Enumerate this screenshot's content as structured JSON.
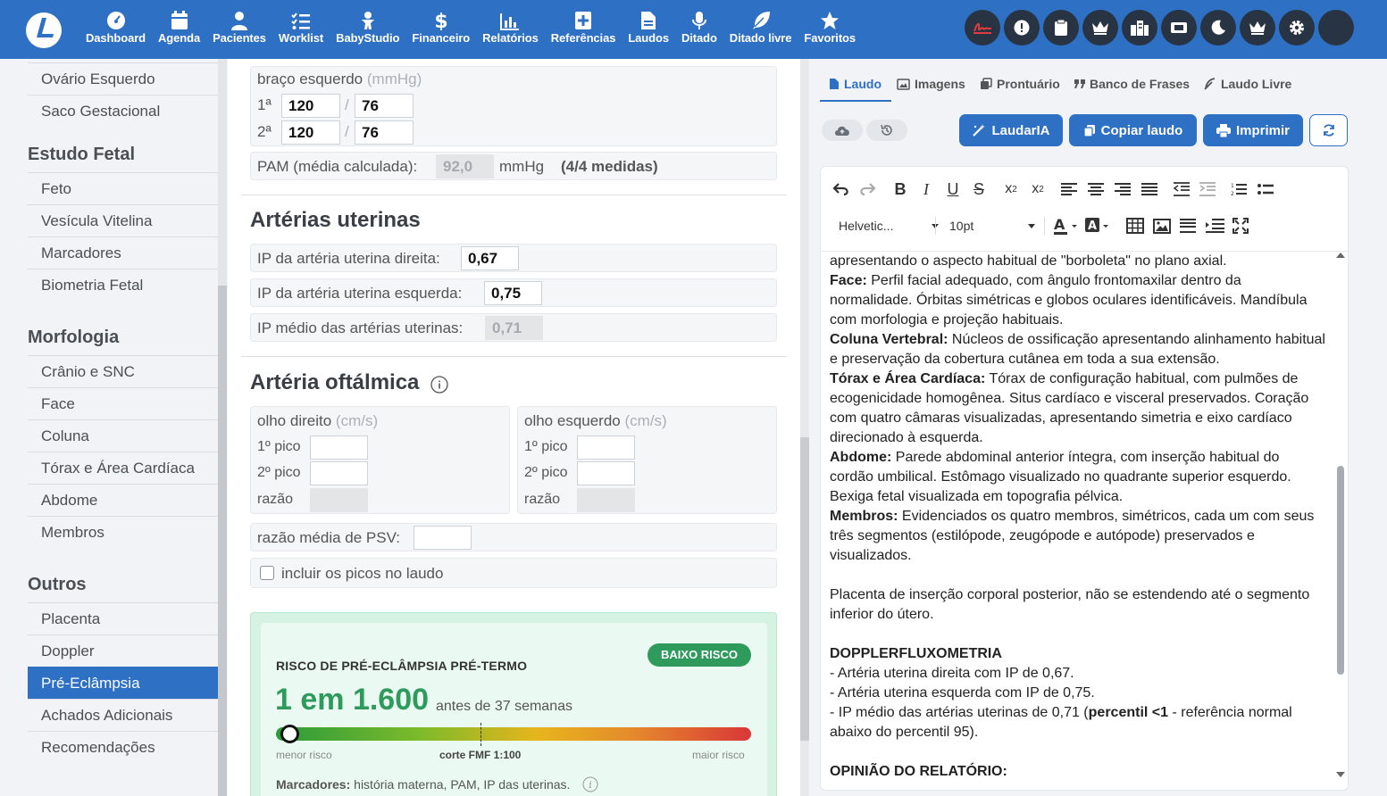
{
  "nav": {
    "items": [
      {
        "label": "Dashboard",
        "icon": "dashboard-icon"
      },
      {
        "label": "Agenda",
        "icon": "calendar-icon"
      },
      {
        "label": "Pacientes",
        "icon": "user-icon"
      },
      {
        "label": "Worklist",
        "icon": "list-check-icon"
      },
      {
        "label": "BabyStudio",
        "icon": "baby-icon"
      },
      {
        "label": "Financeiro",
        "icon": "dollar-icon"
      },
      {
        "label": "Relatórios",
        "icon": "bar-chart-icon"
      },
      {
        "label": "Referências",
        "icon": "book-plus-icon"
      },
      {
        "label": "Laudos",
        "icon": "file-icon"
      },
      {
        "label": "Ditado",
        "icon": "microphone-icon"
      },
      {
        "label": "Ditado livre",
        "icon": "feather-icon"
      },
      {
        "label": "Favoritos",
        "icon": "star-icon"
      }
    ],
    "right_icons": [
      "signature-icon",
      "alert-icon",
      "clipboard-icon",
      "crown-icon",
      "building-icon",
      "ticket-icon",
      "moon-icon",
      "crown-icon",
      "gear-icon",
      "avatar"
    ]
  },
  "sidebar": {
    "items_top": [
      "Ovário Esquerdo",
      "Saco Gestacional"
    ],
    "sections": [
      {
        "title": "Estudo Fetal",
        "items": [
          "Feto",
          "Vesícula Vitelina",
          "Marcadores",
          "Biometria Fetal"
        ]
      },
      {
        "title": "Morfologia",
        "items": [
          "Crânio e SNC",
          "Face",
          "Coluna",
          "Tórax e Área Cardíaca",
          "Abdome",
          "Membros"
        ]
      },
      {
        "title": "Outros",
        "items": [
          "Placenta",
          "Doppler",
          "Pré-Eclâmpsia",
          "Achados Adicionais",
          "Recomendações"
        ]
      }
    ],
    "active": "Pré-Eclâmpsia"
  },
  "bp": {
    "label": "braço esquerdo",
    "unit": "(mmHg)",
    "rows": [
      {
        "ord": "1ª",
        "sys": "120",
        "dia": "76"
      },
      {
        "ord": "2ª",
        "sys": "120",
        "dia": "76"
      }
    ],
    "sep": "/",
    "pam_label": "PAM (média calculada):",
    "pam_value": "92,0",
    "pam_unit": "mmHg",
    "pam_count": "(4/4 medidas)"
  },
  "uterine": {
    "title": "Artérias uterinas",
    "right_label": "IP da artéria uterina direita:",
    "right_value": "0,67",
    "left_label": "IP da artéria uterina esquerda:",
    "left_value": "0,75",
    "mean_label": "IP médio das artérias uterinas:",
    "mean_value": "0,71"
  },
  "ophthalmic": {
    "title": "Artéria oftálmica",
    "right_eye": "olho direito",
    "left_eye": "olho esquerdo",
    "unit": "(cm/s)",
    "peak1": "1º pico",
    "peak2": "2º pico",
    "ratio": "razão",
    "psv_label": "razão média de PSV:",
    "include_label": "incluir os picos no laudo"
  },
  "risk": {
    "title": "RISCO DE PRÉ-ECLÂMPSIA PRÉ-TERMO",
    "badge": "BAIXO RISCO",
    "value": "1 em 1.600",
    "suffix": "antes de 37 semanas",
    "min_label": "menor risco",
    "cut_label": "corte FMF 1:100",
    "max_label": "maior risco",
    "markers_label": "Marcadores:",
    "markers_text": "história materna, PAM, IP das uterinas.",
    "position": 0.03,
    "cutoff_position": 0.43,
    "colors": {
      "badge": "#2e9a5c",
      "value": "#2e9a5c"
    }
  },
  "report": {
    "tabs": [
      {
        "label": "Laudo",
        "icon": "file-icon"
      },
      {
        "label": "Imagens",
        "icon": "image-icon"
      },
      {
        "label": "Prontuário",
        "icon": "copy-icon"
      },
      {
        "label": "Banco de Frases",
        "icon": "quote-icon"
      },
      {
        "label": "Laudo Livre",
        "icon": "pen-icon"
      }
    ],
    "buttons": {
      "ai": "LaudarIA",
      "copy": "Copiar laudo",
      "print": "Imprimir"
    },
    "font": "Helvetic...",
    "size": "10pt",
    "content": [
      {
        "b": "",
        "t": "apresentando o aspecto habitual de \"borboleta\" no plano axial."
      },
      {
        "b": "Face:",
        "t": " Perfil facial adequado, com ângulo frontomaxilar dentro da normalidade. Órbitas simétricas e globos oculares identificáveis. Mandíbula com morfologia e projeção habituais."
      },
      {
        "b": "Coluna Vertebral:",
        "t": " Núcleos de ossificação apresentando alinhamento habitual e preservação da cobertura cutânea em toda a sua extensão."
      },
      {
        "b": "Tórax e Área Cardíaca:",
        "t": " Tórax de configuração habitual, com pulmões de ecogenicidade homogênea. Situs cardíaco e visceral preservados. Coração com quatro câmaras visualizadas, apresentando simetria e eixo cardíaco direcionado à esquerda."
      },
      {
        "b": "Abdome:",
        "t": " Parede abdominal anterior íntegra, com inserção habitual do cordão umbilical. Estômago visualizado no quadrante superior esquerdo. Bexiga fetal visualizada em topografia pélvica."
      },
      {
        "b": "Membros:",
        "t": " Evidenciados os quatro membros, simétricos, cada um com seus três segmentos (estilópode, zeugópode e autópode) preservados e visualizados."
      },
      {
        "b": "",
        "t": ""
      },
      {
        "b": "",
        "t": "Placenta de inserção corporal posterior, não se estendendo até o segmento inferior do útero."
      },
      {
        "b": "",
        "t": ""
      },
      {
        "b": "DOPPLERFLUXOMETRIA",
        "t": ""
      },
      {
        "b": "",
        "t": "- Artéria uterina direita com IP de 0,67."
      },
      {
        "b": "",
        "t": "- Artéria uterina esquerda com IP de 0,75."
      },
      {
        "b": "",
        "t": ""
      },
      {
        "b": "",
        "t": ""
      },
      {
        "b": "OPINIÃO DO RELATÓRIO:",
        "t": ""
      }
    ],
    "ip_line": {
      "pre": "- IP médio das artérias uterinas de 0,71 (",
      "bold": "percentil <1",
      "post": " - referência normal abaixo do percentil 95)."
    }
  }
}
